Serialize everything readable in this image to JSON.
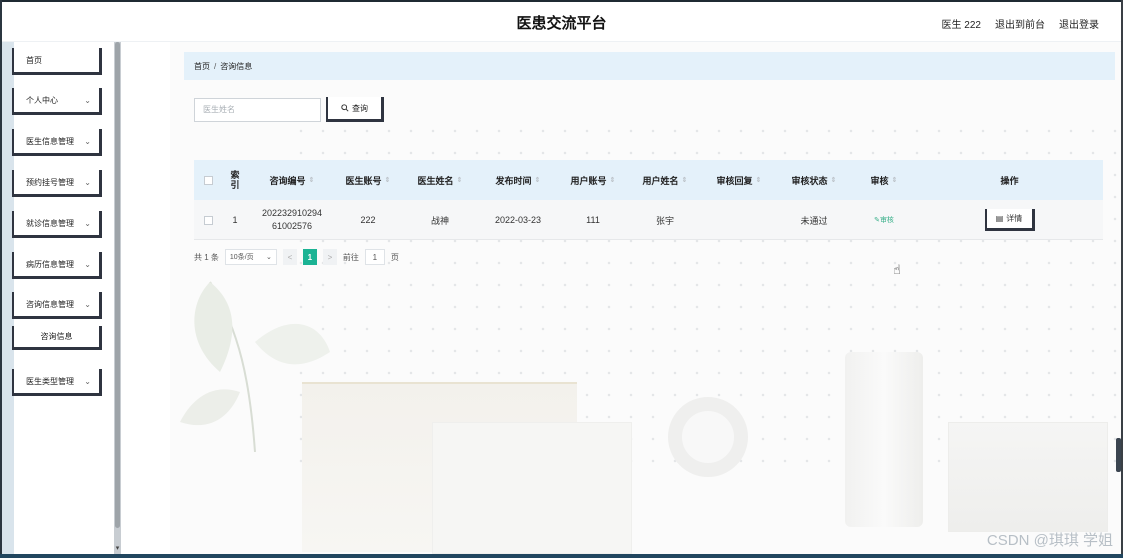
{
  "header": {
    "title": "医患交流平台",
    "user": "医生 222",
    "back_to_front": "退出到前台",
    "logout": "退出登录"
  },
  "sidebar": {
    "items": [
      {
        "label": "首页",
        "has_arrow": false
      },
      {
        "label": "个人中心",
        "has_arrow": true
      },
      {
        "label": "医生信息管理",
        "has_arrow": true
      },
      {
        "label": "预约挂号管理",
        "has_arrow": true
      },
      {
        "label": "就诊信息管理",
        "has_arrow": true
      },
      {
        "label": "病历信息管理",
        "has_arrow": true
      },
      {
        "label": "咨询信息管理",
        "has_arrow": true
      },
      {
        "label": "咨询信息",
        "has_arrow": false
      },
      {
        "label": "医生类型管理",
        "has_arrow": true
      }
    ],
    "chevron": "⌄"
  },
  "breadcrumb": {
    "home": "首页",
    "sep": "/",
    "current": "咨询信息"
  },
  "search": {
    "placeholder": "医生姓名",
    "button_label": "查询",
    "icon": "search-icon"
  },
  "table": {
    "headers": [
      "索引",
      "咨询编号",
      "医生账号",
      "医生姓名",
      "发布时间",
      "用户账号",
      "用户姓名",
      "审核回复",
      "审核状态",
      "审核",
      "操作"
    ],
    "rows": [
      {
        "index": "1",
        "consult_no": "202232910294\n61002576",
        "doctor_account": "222",
        "doctor_name": "战神",
        "publish_time": "2022-03-23",
        "user_account": "111",
        "user_name": "张宇",
        "review_reply": "",
        "review_status": "未通过",
        "review_action": "审核",
        "operation": "详情"
      }
    ]
  },
  "pagination": {
    "total": "共 1 条",
    "page_size": "10条/页",
    "prev": "<",
    "current": "1",
    "next": ">",
    "goto": "前往",
    "goto_value": "1",
    "page_suffix": "页"
  },
  "watermark": "CSDN @琪琪 学姐",
  "colors": {
    "accent": "#1bb394",
    "header_bg": "#e4f1fa",
    "link": "#3ab08a"
  }
}
